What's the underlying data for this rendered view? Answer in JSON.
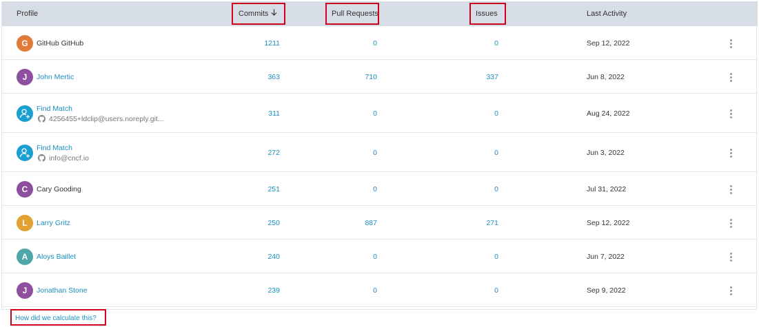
{
  "header": {
    "profile": "Profile",
    "commits": "Commits",
    "pull_requests": "Pull Requests",
    "issues": "Issues",
    "last_activity": "Last Activity",
    "sort_icon": "arrow-down-icon"
  },
  "rows": [
    {
      "initial": "G",
      "avatar_color": "#e07b39",
      "name": "GitHub GitHub",
      "name_style": "plain",
      "commits": "1211",
      "prs": "0",
      "issues": "0",
      "last_activity": "Sep 12, 2022"
    },
    {
      "initial": "J",
      "avatar_color": "#8e4f9e",
      "name": "John Mertic",
      "name_style": "link",
      "commits": "363",
      "prs": "710",
      "issues": "337",
      "last_activity": "Jun 8, 2022"
    },
    {
      "initial": "",
      "avatar_icon": "add-user-icon",
      "avatar_color": "#1a9fd1",
      "name": "Find Match",
      "name_style": "link",
      "sub": "4256455+ldclip@users.noreply.git...",
      "sub_icon": "github-icon",
      "commits": "311",
      "prs": "0",
      "issues": "0",
      "last_activity": "Aug 24, 2022"
    },
    {
      "initial": "",
      "avatar_icon": "add-user-icon",
      "avatar_color": "#1a9fd1",
      "name": "Find Match",
      "name_style": "link",
      "sub": "info@cncf.io",
      "sub_icon": "github-icon",
      "commits": "272",
      "prs": "0",
      "issues": "0",
      "last_activity": "Jun 3, 2022"
    },
    {
      "initial": "C",
      "avatar_color": "#8e4f9e",
      "name": "Cary Gooding",
      "name_style": "plain",
      "commits": "251",
      "prs": "0",
      "issues": "0",
      "last_activity": "Jul 31, 2022"
    },
    {
      "initial": "L",
      "avatar_color": "#e2a133",
      "name": "Larry Gritz",
      "name_style": "link",
      "commits": "250",
      "prs": "887",
      "issues": "271",
      "last_activity": "Sep 12, 2022"
    },
    {
      "initial": "A",
      "avatar_color": "#4fa6a8",
      "name": "Aloys Baillet",
      "name_style": "link",
      "commits": "240",
      "prs": "0",
      "issues": "0",
      "last_activity": "Jun 7, 2022"
    },
    {
      "initial": "J",
      "avatar_color": "#8e4f9e",
      "name": "Jonathan Stone",
      "name_style": "link",
      "commits": "239",
      "prs": "0",
      "issues": "0",
      "last_activity": "Sep 9, 2022"
    }
  ],
  "row_menu_icon": "kebab-menu-icon",
  "footer": {
    "calc_link": "How did we calculate this?"
  },
  "colors": {
    "link": "#1a8fbf",
    "header_bg": "#d6dde5",
    "highlight_box": "#d0021b"
  }
}
